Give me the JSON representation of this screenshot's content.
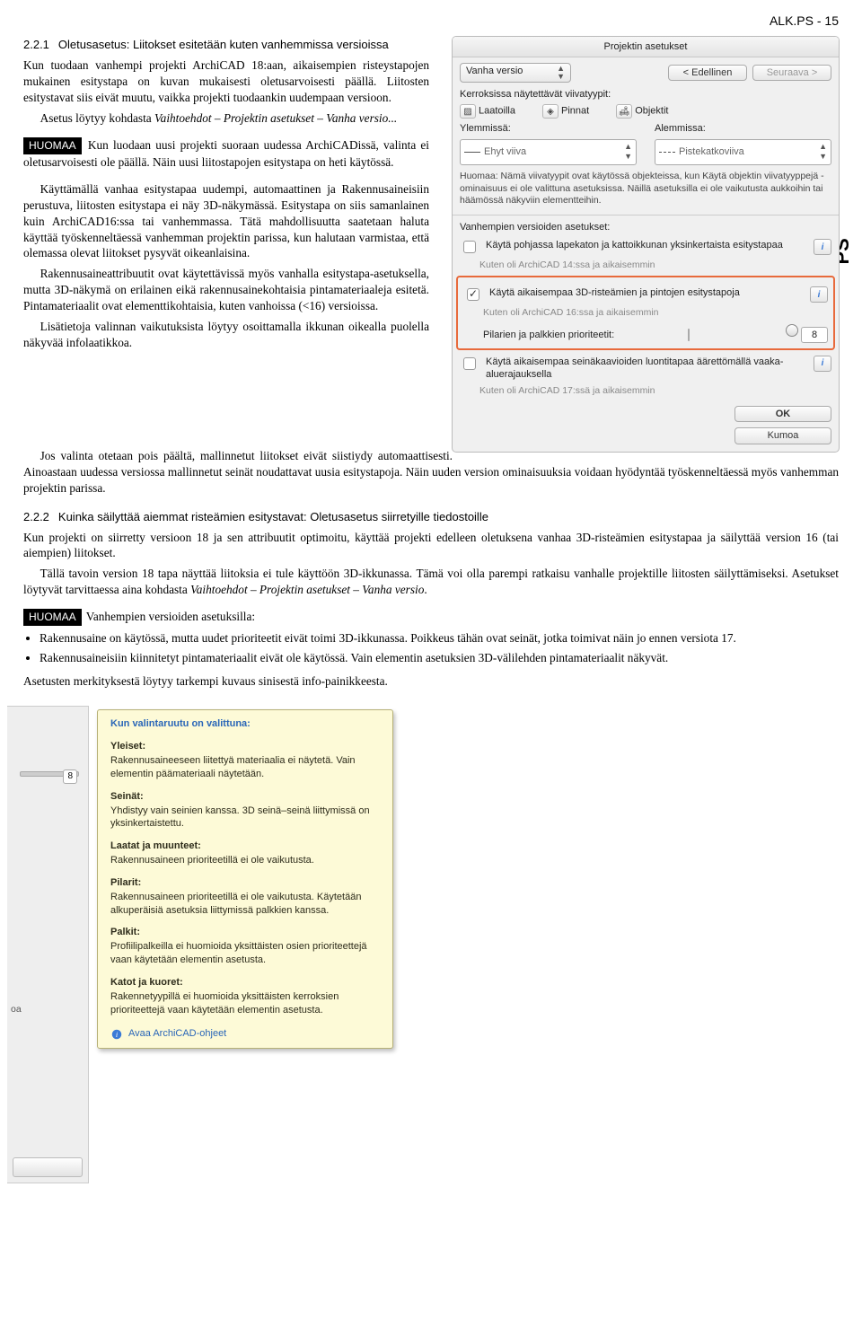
{
  "header": {
    "page_ref": "ALK.PS - 15"
  },
  "side_tab": "PS",
  "section_221": {
    "num": "2.2.1",
    "title": "Oletusasetus: Liitokset esitetään kuten vanhemmissa versioissa",
    "p1": "Kun tuodaan vanhempi projekti ArchiCAD 18:aan, aikaisempien risteystapojen mukainen esitystapa on kuvan mukaisesti oletusarvoisesti päällä. Liitosten esitystavat siis eivät muutu, vaikka projekti tuodaankin uudempaan versioon.",
    "p2a": "Asetus löytyy kohdasta ",
    "p2b": "Vaihtoehdot – Projektin asetukset – Vanha versio...",
    "huomaa": "HUOMAA",
    "p3": " Kun luodaan uusi projekti suoraan uudessa ArchiCADissä, valinta ei oletusarvoisesti ole päällä. Näin uusi liitostapojen esitystapa on heti käytössä.",
    "p4": "Käyttämällä vanhaa esitystapaa uudempi, automaattinen ja Rakennusaineisiin perustuva, liitosten esitystapa ei näy 3D-näkymässä. Esitystapa on siis samanlainen kuin ArchiCAD16:ssa tai vanhemmassa. Tätä mahdollisuutta saatetaan haluta käyttää työskenneltäessä vanhemman projektin parissa, kun halutaan varmistaa, että olemassa olevat liitokset pysyvät oikeanlaisina.",
    "p5": "Rakennusaineattribuutit ovat käytettävissä myös vanhalla esitystapa-asetuksella, mutta 3D-näkymä on erilainen eikä rakennusainekohtaisia pintamateriaaleja esitetä. Pintamateriaalit ovat elementtikohtaisia, kuten vanhoissa (<16) versioissa.",
    "p6": "Lisätietoja valinnan vaikutuksista löytyy osoittamalla ikkunan oikealla puolella näkyvää infolaatikkoa.",
    "p7": "Jos valinta otetaan pois päältä, mallinnetut liitokset eivät siistiydy automaattisesti. Ainoastaan uudessa versiossa mallinnetut seinät noudattavat uusia esitystapoja. Näin uuden version ominaisuuksia voidaan hyödyntää työskenneltäessä myös vanhemman projektin parissa."
  },
  "section_222": {
    "num": "2.2.2",
    "title": "Kuinka säilyttää aiemmat risteämien esitystavat: Oletusasetus siirretyille tiedostoille",
    "p1": "Kun projekti on siirretty versioon 18 ja sen attribuutit optimoitu, käyttää projekti edelleen oletuksena vanhaa 3D-risteämien esitystapaa ja säilyttää version 16 (tai aiempien) liitokset.",
    "p2a": "Tällä tavoin version 18 tapa näyttää liitoksia ei tule käyttöön 3D-ikkunassa. Tämä voi olla parempi ratkaisu vanhalle projektille liitosten säilyttämiseksi. Asetukset löytyvät tarvittaessa aina kohdasta ",
    "p2b": "Vaihtoehdot – Projektin asetukset – Vanha versio",
    "huomaa": "HUOMAA",
    "lead": " Vanhempien versioiden asetuksilla:",
    "b1": "Rakennusaine on käytössä, mutta uudet prioriteetit eivät toimi 3D-ikkunassa. Poikkeus tähän ovat seinät, jotka toimivat näin jo ennen versiota 17.",
    "b2": "Rakennusaineisiin kiinnitetyt pintamateriaalit eivät ole käytössä. Vain elementin asetuksien 3D-välilehden pintamateriaalit näkyvät.",
    "p3": "Asetusten merkityksestä löytyy tarkempi kuvaus sinisestä info-painikkeesta."
  },
  "panel": {
    "title": "Projektin asetukset",
    "version_select": "Vanha versio",
    "prev_btn": "< Edellinen",
    "next_btn": "Seuraava >",
    "layers_label": "Kerroksissa näytettävät viivatyypit:",
    "chip_laatoilla": "Laatoilla",
    "chip_pinnat": "Pinnat",
    "chip_objektit": "Objektit",
    "ylemmissa": "Ylemmissä:",
    "alemmissa": "Alemmissa:",
    "drop_ehyt": "Ehyt viiva",
    "drop_piste": "Pistekatkoviiva",
    "note": "Huomaa: Nämä viivatyypit ovat käytössä objekteissa, kun Käytä objektin viivatyyppejä -ominaisuus ei ole valittuna asetuksissa. Näillä asetuksilla ei ole vaikutusta aukkoihin tai häämössä näkyviin elementteihin.",
    "older_label": "Vanhempien versioiden asetukset:",
    "c1": "Käytä pohjassa lapekaton ja kattoikkunan yksinkertaista esitystapaa",
    "c1_sub": "Kuten oli ArchiCAD 14:ssa ja aikaisemmin",
    "c2": "Käytä aikaisempaa 3D-risteämien ja pintojen esitystapoja",
    "c2_sub": "Kuten oli ArchiCAD 16:ssa ja aikaisemmin",
    "c2_extra": "Pilarien ja palkkien prioriteetit:",
    "slider_val": "8",
    "c3": "Käytä aikaisempaa seinäkaavioiden luontitapaa äärettömällä vaaka-aluerajauksella",
    "c3_sub": "Kuten oli ArchiCAD 17:ssä ja aikaisemmin",
    "ok": "OK",
    "cancel": "Kumoa"
  },
  "tooltip": {
    "head": "Kun valintaruutu on valittuna:",
    "s1t": "Yleiset:",
    "s1b": "Rakennusaineeseen liitettyä materiaalia ei näytetä. Vain elementin päämateriaali näytetään.",
    "s2t": "Seinät:",
    "s2b": "Yhdistyy vain seinien kanssa. 3D seinä–seinä liittymissä on yksinkertaistettu.",
    "s3t": "Laatat ja muunteet:",
    "s3b": "Rakennusaineen prioriteetillä ei ole vaikutusta.",
    "s4t": "Pilarit:",
    "s4b": "Rakennusaineen prioriteetillä ei ole vaikutusta. Käytetään alkuperäisiä asetuksia liittymissä palkkien kanssa.",
    "s5t": "Palkit:",
    "s5b": "Profiilipalkeilla ei huomioida yksittäisten osien prioriteettejä vaan käytetään elementin asetusta.",
    "s6t": "Katot ja kuoret:",
    "s6b": "Rakennetyypillä ei huomioida yksittäisten kerroksien prioriteettejä vaan käytetään elementin asetusta.",
    "footer": "Avaa ArchiCAD-ohjeet",
    "gutter_tag": "oa",
    "gutter_val": "8"
  }
}
